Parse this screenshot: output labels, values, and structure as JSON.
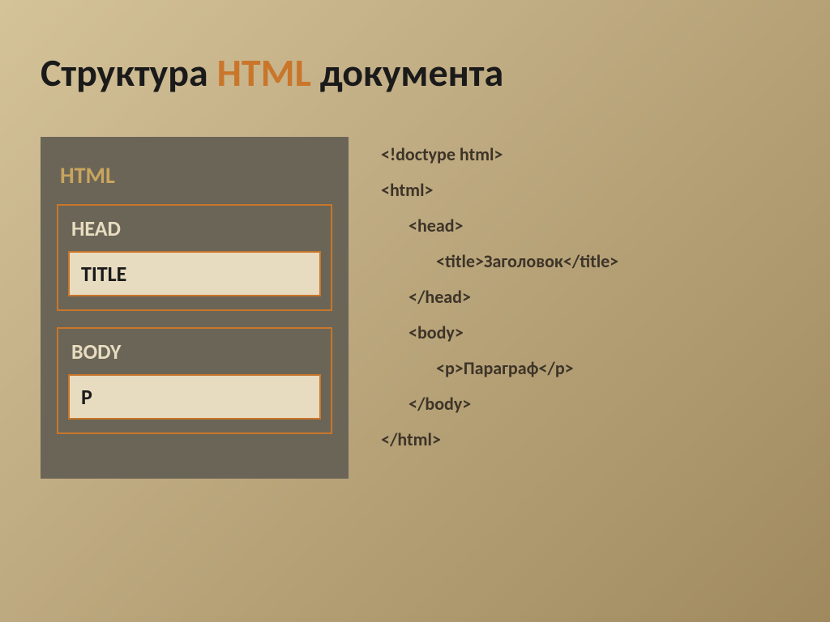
{
  "heading": {
    "pre": "Структура ",
    "accent": "HTML",
    "post": " документа"
  },
  "diagram": {
    "html": "HTML",
    "head": "HEAD",
    "title": "TITLE",
    "body": "BODY",
    "p": "P"
  },
  "code": {
    "l1": "<!doctype html>",
    "l2": "<html>",
    "l3": "<head>",
    "l4": "<title>Заголовок</title>",
    "l5": "</head>",
    "l6": "<body>",
    "l7": "<p>Параграф</p>",
    "l8": "</body>",
    "l9": "</html>"
  }
}
